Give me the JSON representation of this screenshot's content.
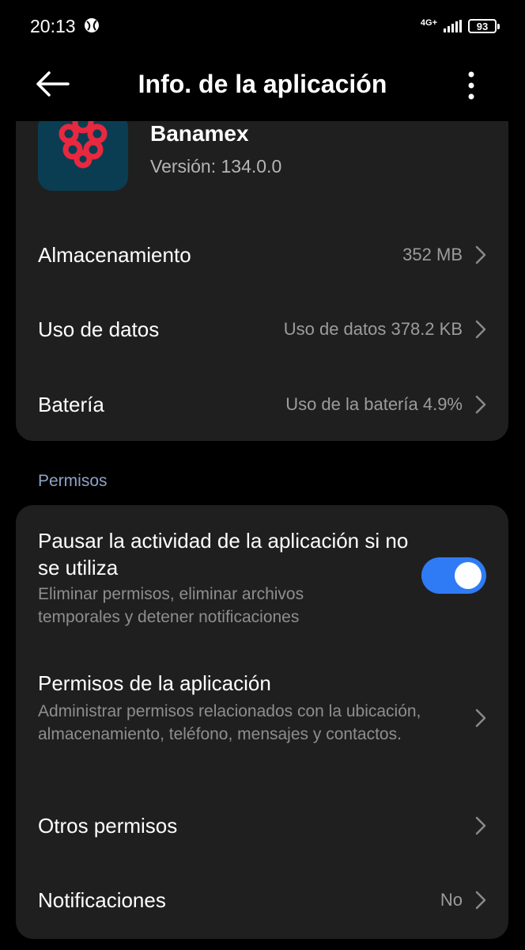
{
  "status_bar": {
    "time": "20:13",
    "network": "4G+",
    "battery": "93"
  },
  "header": {
    "title": "Info. de la aplicación",
    "back_icon": "arrow-left-icon",
    "more_icon": "more-vert-icon"
  },
  "app": {
    "name": "Banamex",
    "version": "Versión: 134.0.0",
    "icon": "banamex-logo",
    "icon_bg": "#0b3d52",
    "icon_color": "#e8283f"
  },
  "details": [
    {
      "label": "Almacenamiento",
      "value": "352 MB"
    },
    {
      "label": "Uso de datos",
      "value": "Uso de datos 378.2 KB"
    },
    {
      "label": "Batería",
      "value": "Uso de la batería 4.9%"
    }
  ],
  "permissions": {
    "section_label": "Permisos",
    "pause": {
      "title": "Pausar la actividad de la aplicación si no se utiliza",
      "description": "Eliminar permisos, eliminar archivos temporales y detener notificaciones",
      "enabled": true
    },
    "app_permissions": {
      "title": "Permisos de la aplicación",
      "description": "Administrar permisos relacionados con la ubicación, almacenamiento, teléfono, mensajes y contactos."
    },
    "other": {
      "title": "Otros permisos"
    },
    "notifications": {
      "title": "Notificaciones",
      "value": "No"
    }
  },
  "colors": {
    "accent": "#2f7bf5",
    "card": "#1f1f1f",
    "section_label": "#8fa3c6"
  }
}
